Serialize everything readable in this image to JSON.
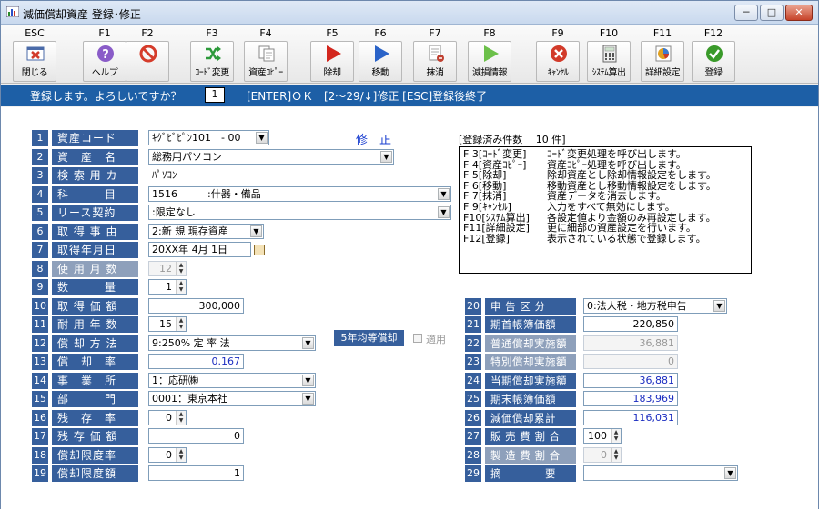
{
  "window": {
    "title": "減価償却資産 登録･修正",
    "minimize": "─",
    "maximize": "□",
    "close": "✕"
  },
  "toolbar": [
    {
      "key": "ESC",
      "label": "閉じる",
      "icon": "close-window-icon",
      "color": "#d23b2a"
    },
    {
      "key": "F1",
      "label": "ヘルプ",
      "icon": "help-icon",
      "color": "#8a5cc8"
    },
    {
      "key": "F2",
      "label": "",
      "icon": "prohibit-icon",
      "color": "#d53c2b"
    },
    {
      "key": "F3",
      "label": "ｺｰﾄﾞ変更",
      "icon": "shuffle-icon",
      "color": "#2c9a3a"
    },
    {
      "key": "F4",
      "label": "資産ｺﾋﾟｰ",
      "icon": "copy-icon",
      "color": "#888888"
    },
    {
      "key": "F5",
      "label": "除却",
      "icon": "arrow-right-red-icon",
      "color": "#d3271e"
    },
    {
      "key": "F6",
      "label": "移動",
      "icon": "arrow-right-blue-icon",
      "color": "#2a63c8"
    },
    {
      "key": "F7",
      "label": "抹消",
      "icon": "erase-doc-icon",
      "color": "#c04030"
    },
    {
      "key": "F8",
      "label": "減損情報",
      "icon": "arrow-right-green-icon",
      "color": "#6cc04a"
    },
    {
      "key": "F9",
      "label": "ｷｬﾝｾﾙ",
      "icon": "cancel-icon",
      "color": "#d23b2a"
    },
    {
      "key": "F10",
      "label": "ｼｽﾃﾑ算出",
      "icon": "calculator-icon",
      "color": "#666666"
    },
    {
      "key": "F11",
      "label": "詳細設定",
      "icon": "detail-settings-icon",
      "color": "#e0a020"
    },
    {
      "key": "F12",
      "label": "登録",
      "icon": "check-icon",
      "color": "#3a9a2a"
    }
  ],
  "message": {
    "question": "登録します。よろしいですか？",
    "input_value": "1",
    "hint_enter": "[ENTER]ＯＫ",
    "hint_other": "[2～29/↓]修正 [ESC]登録後終了"
  },
  "left_fields": [
    {
      "no": "1",
      "label": "資産コード",
      "value": "ｷｸﾞﾋﾞﾋﾟﾝ101　- 00",
      "dropdown": true
    },
    {
      "no": "2",
      "label": "資　産　名",
      "value": "総務用パソコン",
      "dropdown": true
    },
    {
      "no": "3",
      "label": "検 索 用 カ",
      "value": "ﾊﾟｿｺﾝ"
    },
    {
      "no": "4",
      "label": "科　　　目",
      "value": "1516　　　:什器・備品",
      "dropdown": true
    },
    {
      "no": "5",
      "label": "リース契約",
      "value": ":限定なし",
      "dropdown": true
    },
    {
      "no": "6",
      "label": "取 得 事 由",
      "value": "2:新 規 現存資産",
      "dropdown": true
    },
    {
      "no": "7",
      "label": "取得年月日",
      "value": "20XX年 4月 1日"
    },
    {
      "no": "8",
      "label": "使 用 月 数",
      "value": "12",
      "disabled": true
    },
    {
      "no": "9",
      "label": "数　　　量",
      "value": "1"
    },
    {
      "no": "10",
      "label": "取 得 価 額",
      "value": "300,000"
    },
    {
      "no": "11",
      "label": "耐 用 年 数",
      "value": "15"
    },
    {
      "no": "12",
      "label": "償 却 方 法",
      "value": "9:250% 定 率 法",
      "dropdown": true
    },
    {
      "no": "13",
      "label": "償　却　率",
      "value": "0.167"
    },
    {
      "no": "14",
      "label": "事　業　所",
      "value": "1：応研㈱",
      "dropdown": true
    },
    {
      "no": "15",
      "label": "部　　　門",
      "value": "0001：東京本社",
      "dropdown": true
    },
    {
      "no": "16",
      "label": "残　存　率",
      "value": "0"
    },
    {
      "no": "17",
      "label": "残 存 価 額",
      "value": "0"
    },
    {
      "no": "18",
      "label": "償却限度率",
      "value": "0"
    },
    {
      "no": "19",
      "label": "償却限度額",
      "value": "1"
    }
  ],
  "shuusei_label": "修　正",
  "five_year_button": "5年均等償却",
  "apply_checkbox": "適用",
  "registered": {
    "title": "[登録済み件数　 10 件]",
    "lines": [
      {
        "k": "F 3[ｺｰﾄﾞ変更]",
        "v": "ｺｰﾄﾞ変更処理を呼び出します。"
      },
      {
        "k": "F 4[資産ｺﾋﾟｰ]",
        "v": "資産ｺﾋﾟｰ処理を呼び出します。"
      },
      {
        "k": "F 5[除却]",
        "v": "除却資産とし除却情報設定をします。"
      },
      {
        "k": "F 6[移動]",
        "v": "移動資産とし移動情報設定をします。"
      },
      {
        "k": "F 7[抹消]",
        "v": "資産データを消去します。"
      },
      {
        "k": "F 9[ｷｬﾝｾﾙ]",
        "v": "入力をすべて無効にします。"
      },
      {
        "k": "F10[ｼｽﾃﾑ算出]",
        "v": "各設定値より金額のみ再設定します。"
      },
      {
        "k": "F11[詳細設定]",
        "v": "更に細部の資産設定を行います。"
      },
      {
        "k": "F12[登録]",
        "v": "表示されている状態で登録します。"
      }
    ]
  },
  "right_fields": [
    {
      "no": "20",
      "label": "申 告 区 分",
      "value": "0:法人税・地方税申告",
      "dropdown": true
    },
    {
      "no": "21",
      "label": "期首帳簿価額",
      "value": "220,850"
    },
    {
      "no": "22",
      "label": "普通償却実施額",
      "value": "36,881",
      "disabled": true
    },
    {
      "no": "23",
      "label": "特別償却実施額",
      "value": "0",
      "disabled": true
    },
    {
      "no": "24",
      "label": "当期償却実施額",
      "value": "36,881",
      "blue": true
    },
    {
      "no": "25",
      "label": "期末帳簿価額",
      "value": "183,969",
      "blue": true
    },
    {
      "no": "26",
      "label": "減価償却累計",
      "value": "116,031",
      "blue": true
    },
    {
      "no": "27",
      "label": "販 売 費 割 合",
      "value": "100"
    },
    {
      "no": "28",
      "label": "製 造 費 割 合",
      "value": "0",
      "disabled": true
    },
    {
      "no": "29",
      "label": "摘　　　　要",
      "value": "",
      "dropdown": true
    }
  ]
}
